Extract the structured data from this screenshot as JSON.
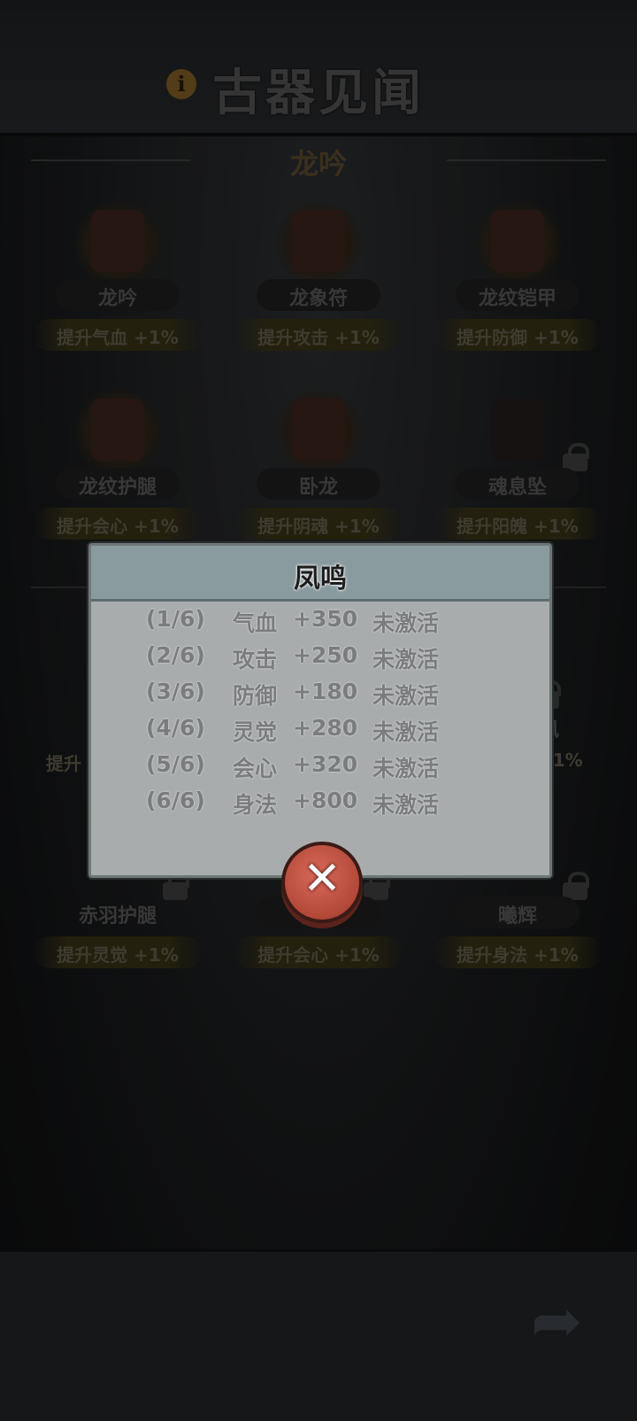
{
  "header": {
    "title": "古器见闻",
    "info_icon": "info-icon"
  },
  "section": {
    "title": "龙吟"
  },
  "items": [
    {
      "name": "龙吟",
      "bonus": "提升气血 +1%",
      "locked": false
    },
    {
      "name": "龙象符",
      "bonus": "提升攻击 +1%",
      "locked": false
    },
    {
      "name": "龙纹铠甲",
      "bonus": "提升防御 +1%",
      "locked": false
    },
    {
      "name": "龙纹护腿",
      "bonus": "提升会心 +1%",
      "locked": false
    },
    {
      "name": "卧龙",
      "bonus": "提升阴魂 +1%",
      "locked": false
    },
    {
      "name": "魂息坠",
      "bonus": "提升阳魄 +1%",
      "locked": true
    }
  ],
  "items_row3": [
    {
      "name": "",
      "bonus": "提升",
      "locked": false
    },
    {
      "name": "风",
      "bonus": "+1%",
      "locked": true
    }
  ],
  "items_row4": [
    {
      "name": "赤羽护腿",
      "bonus": "提升灵觉 +1%",
      "locked": true
    },
    {
      "name": "栖阳",
      "bonus": "提升会心 +1%",
      "locked": true
    },
    {
      "name": "曦辉",
      "bonus": "提升身法 +1%",
      "locked": true
    }
  ],
  "modal": {
    "title": "凤鸣",
    "rows": [
      {
        "idx": "(1/6)",
        "stat": "气血",
        "value": "+350",
        "state": "未激活"
      },
      {
        "idx": "(2/6)",
        "stat": "攻击",
        "value": "+250",
        "state": "未激活"
      },
      {
        "idx": "(3/6)",
        "stat": "防御",
        "value": "+180",
        "state": "未激活"
      },
      {
        "idx": "(4/6)",
        "stat": "灵觉",
        "value": "+280",
        "state": "未激活"
      },
      {
        "idx": "(5/6)",
        "stat": "会心",
        "value": "+320",
        "state": "未激活"
      },
      {
        "idx": "(6/6)",
        "stat": "身法",
        "value": "+800",
        "state": "未激活"
      }
    ],
    "close_label": "✕"
  },
  "footer": {
    "share_icon": "share-arrow-icon",
    "share_glyph": "➦"
  }
}
